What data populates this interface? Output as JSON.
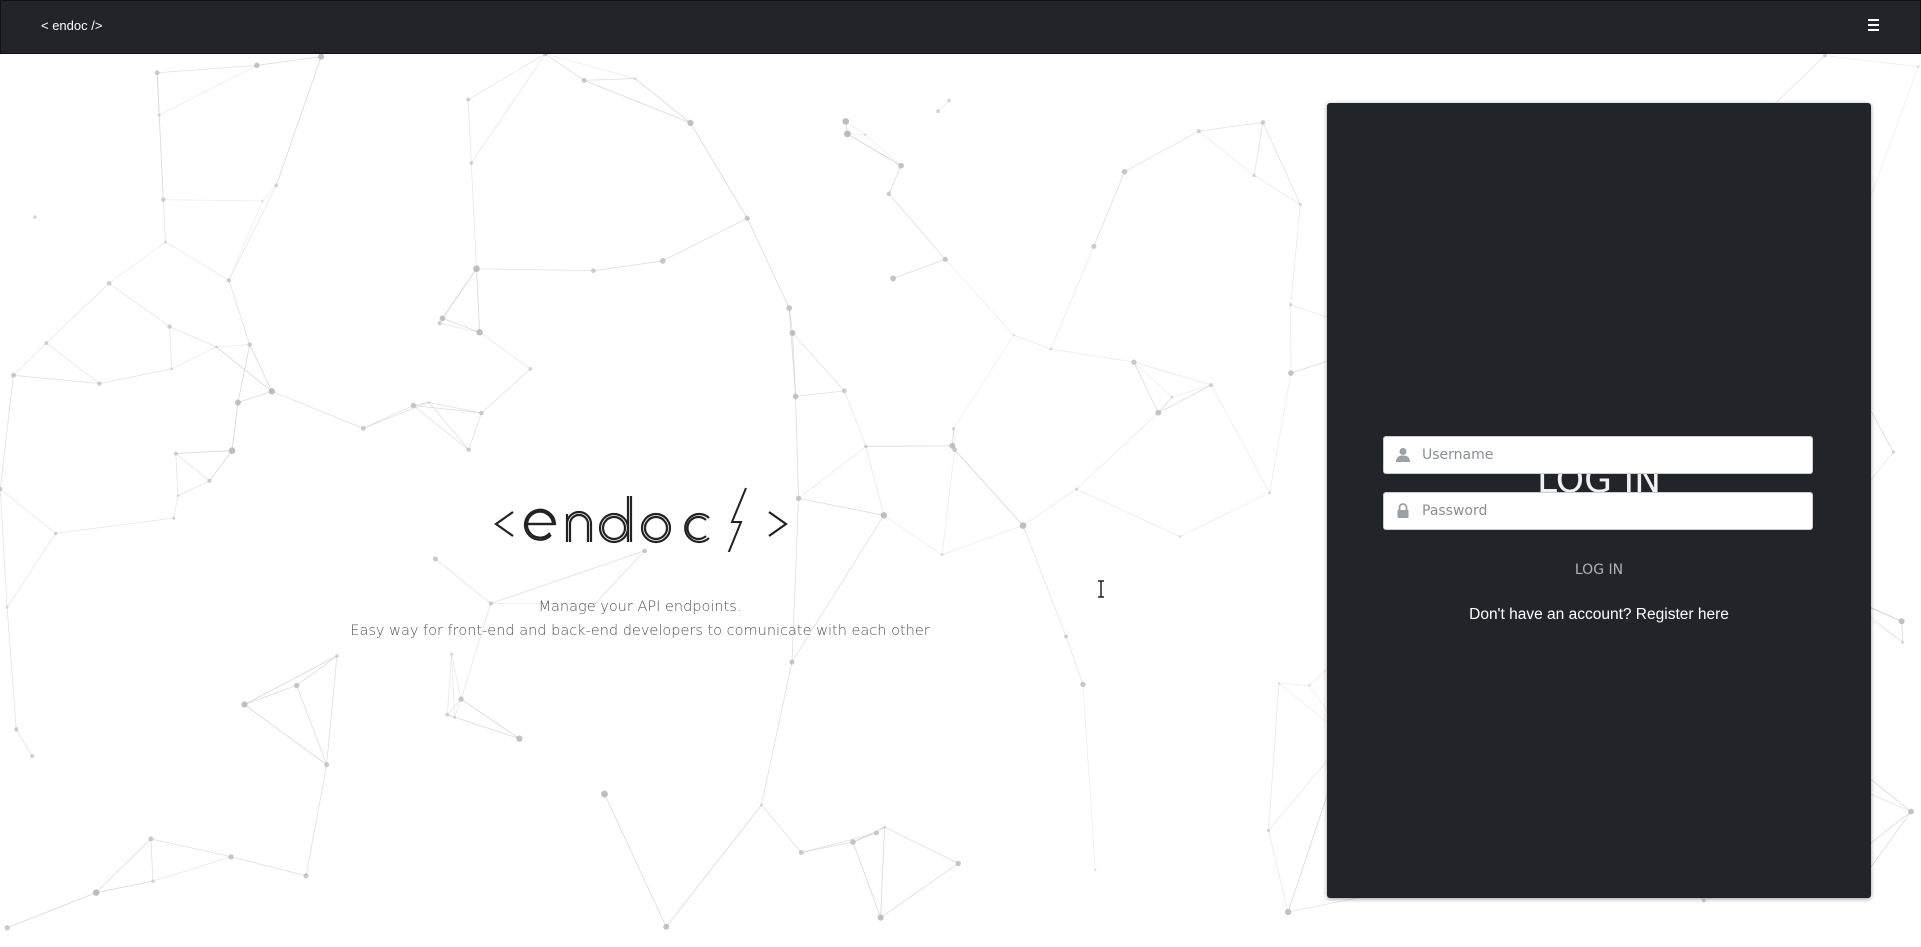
{
  "navbar": {
    "brand": "< endoc />",
    "menu_icon": "hamburger-menu-icon"
  },
  "hero": {
    "logo_text": "<endoc />",
    "tagline_line1": "Manage your API endpoints.",
    "tagline_line2": "Easy way for front-end and back-end developers to comunicate with each other"
  },
  "login": {
    "title": "LOG IN",
    "username_placeholder": "Username",
    "username_icon": "user-icon",
    "password_placeholder": "Password",
    "password_icon": "lock-icon",
    "submit_label": "LOG IN",
    "register_text": "Don't have an account? Register here"
  },
  "colors": {
    "navbar_bg": "#212529",
    "card_bg": "#212529",
    "network_line": "#cfcfcf",
    "network_node": "#b5b5b5"
  }
}
